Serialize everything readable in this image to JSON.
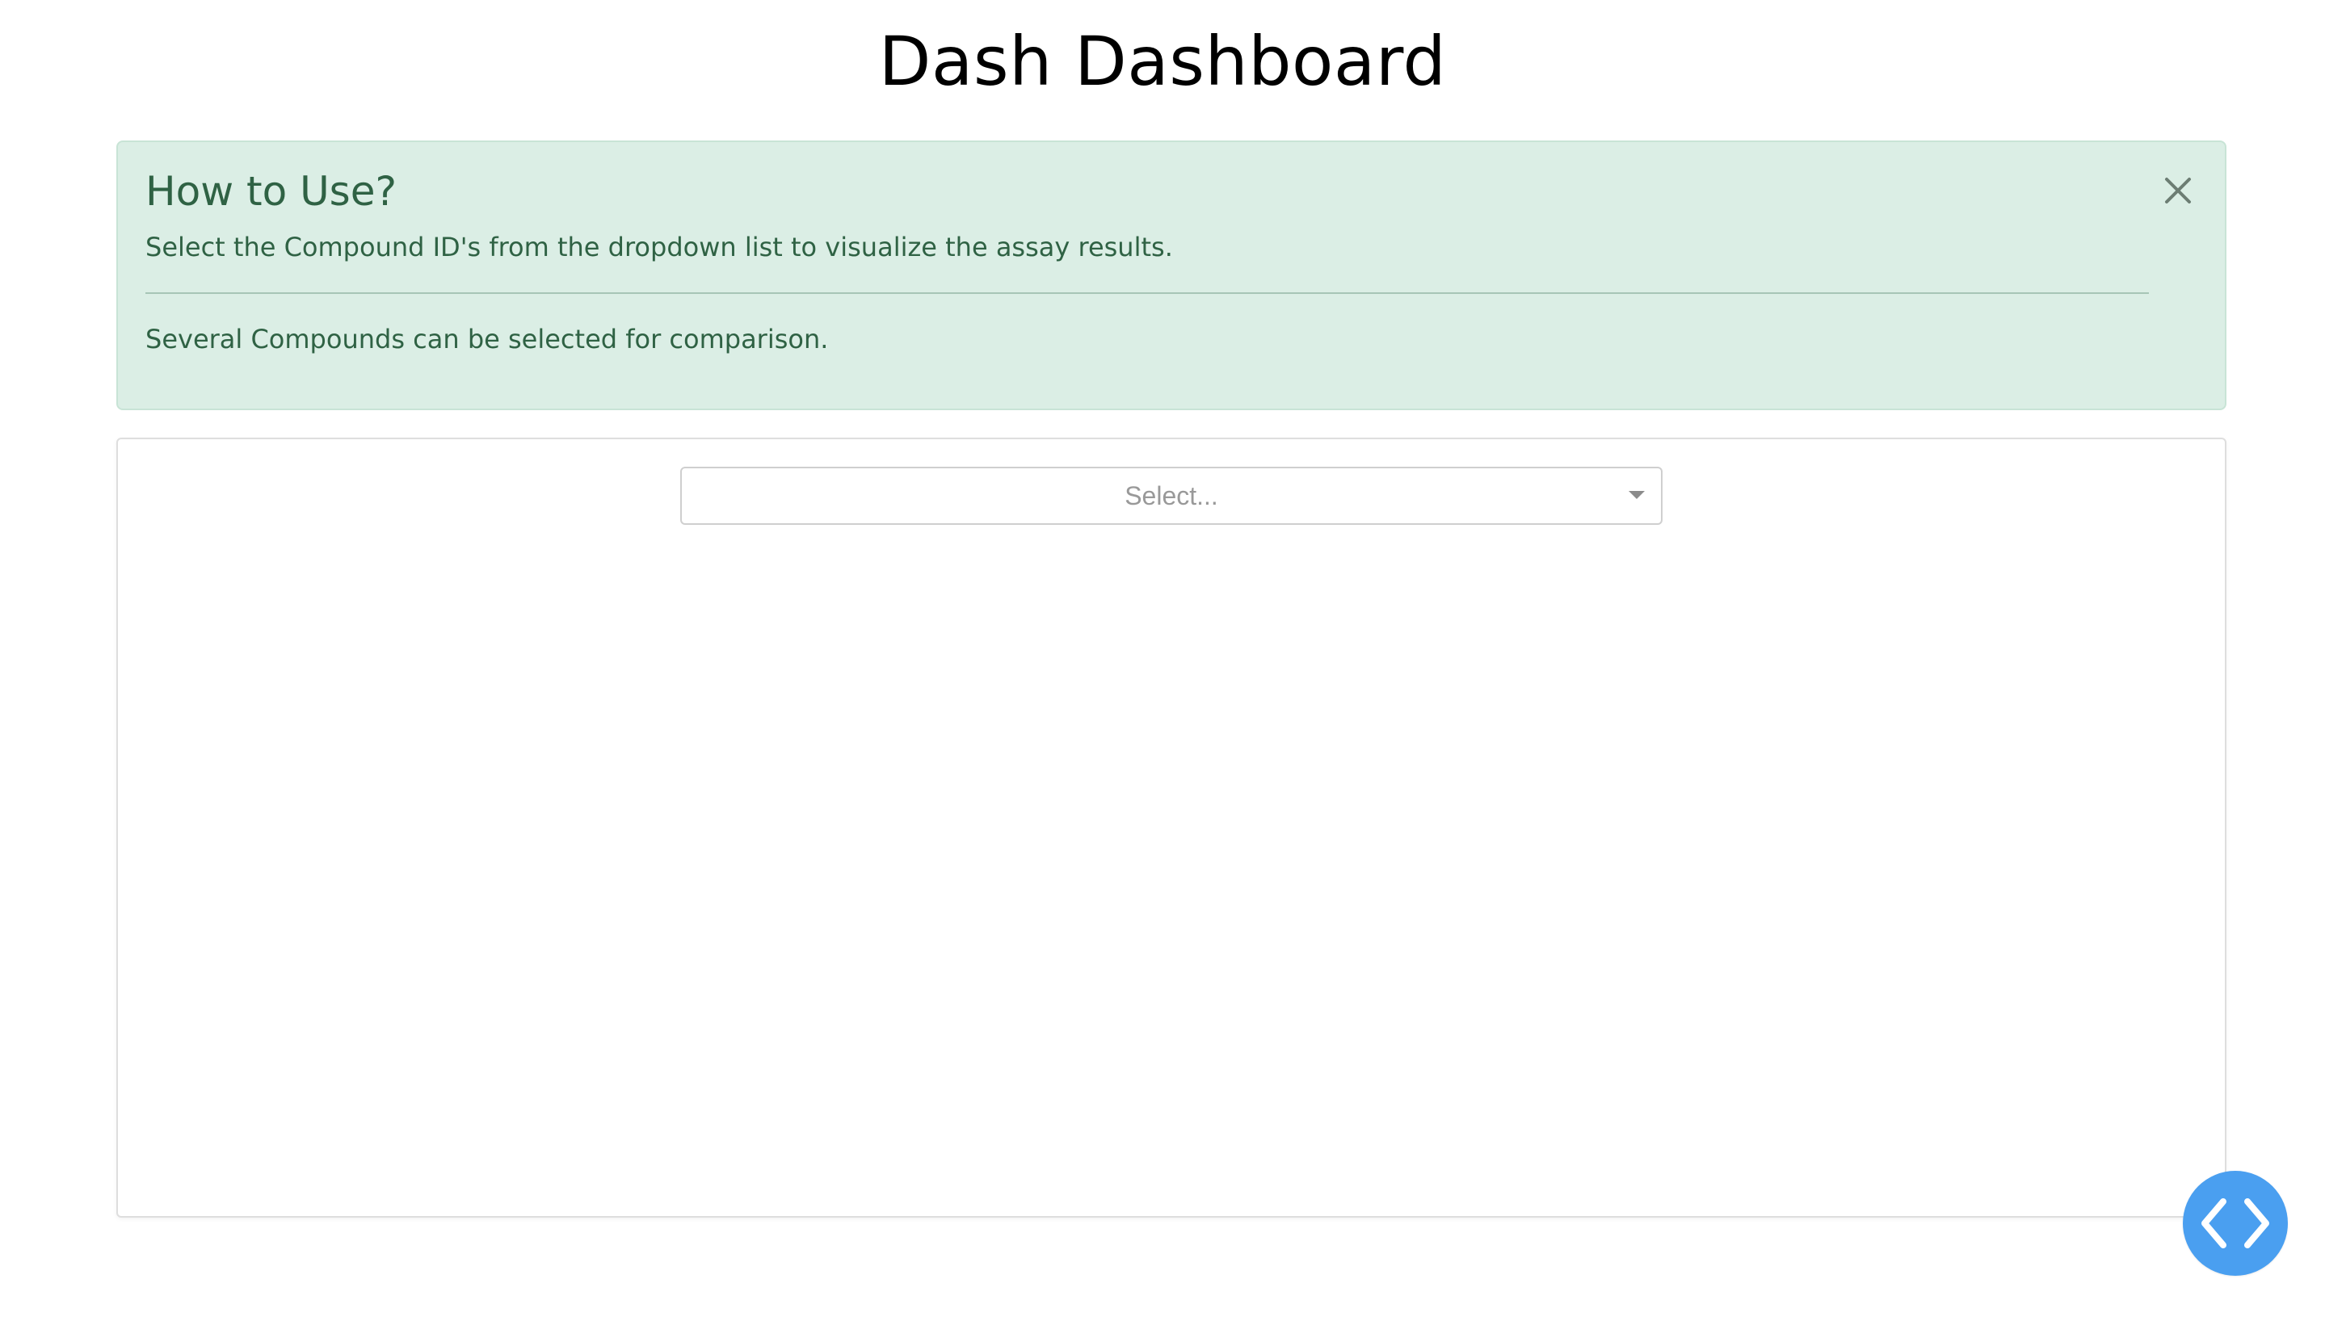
{
  "page": {
    "title": "Dash Dashboard"
  },
  "alert": {
    "heading": "How to Use?",
    "line_1": "Select the Compound ID's from the dropdown list to visualize the assay results.",
    "line_2": "Several Compounds can be selected for comparison.",
    "close_icon": "close-icon",
    "background_color": "#dbeee5",
    "text_color": "#2f6244"
  },
  "compound_selector": {
    "placeholder": "Select...",
    "dropdown_icon": "chevron-down-icon"
  },
  "floating_button": {
    "icon": "code-brackets-icon",
    "color": "#4a9ff0"
  }
}
